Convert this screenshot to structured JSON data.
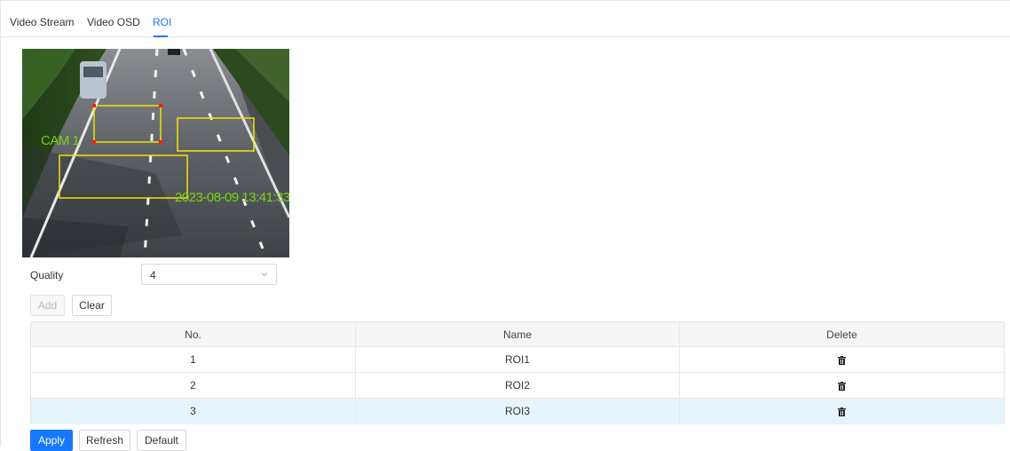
{
  "tabs": [
    {
      "label": "Video Stream",
      "active": false
    },
    {
      "label": "Video OSD",
      "active": false
    },
    {
      "label": "ROI",
      "active": true
    }
  ],
  "accent_color": "#1677ff",
  "preview": {
    "osd_channel": "CAM 1",
    "osd_time": "2023-08-09 13:41:33",
    "roi_box_color": "#f2e600",
    "handle_color": "#ff1a1a"
  },
  "quality": {
    "label": "Quality",
    "value": "4"
  },
  "actions": {
    "add": "Add",
    "clear": "Clear"
  },
  "table": {
    "columns": [
      "No.",
      "Name",
      "Delete"
    ],
    "rows": [
      {
        "no": "1",
        "name": "ROI1",
        "delete_icon": "trash-icon"
      },
      {
        "no": "2",
        "name": "ROI2",
        "delete_icon": "trash-icon"
      },
      {
        "no": "3",
        "name": "ROI3",
        "delete_icon": "trash-icon",
        "selected": true
      }
    ]
  },
  "footer": {
    "apply": "Apply",
    "refresh": "Refresh",
    "default": "Default"
  }
}
